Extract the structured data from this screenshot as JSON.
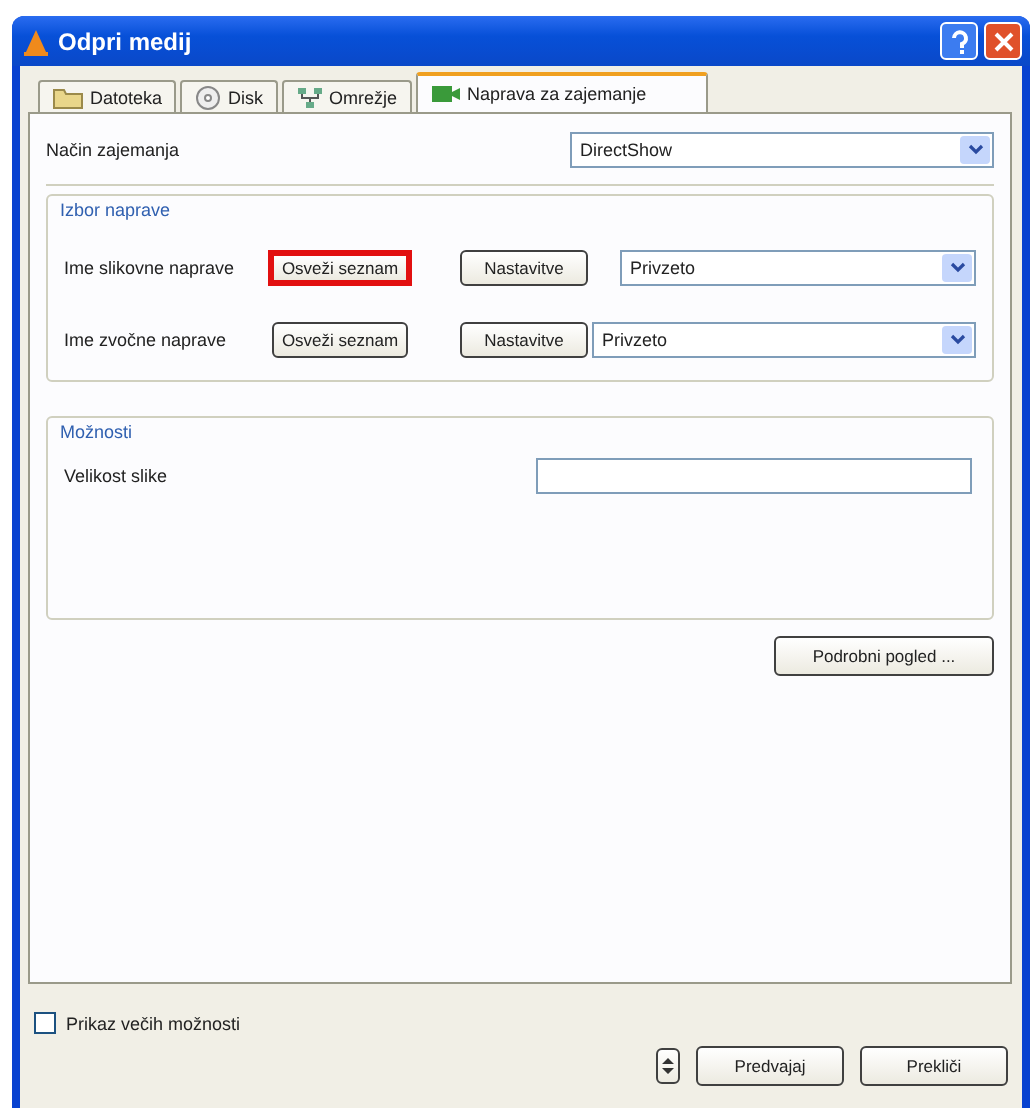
{
  "window": {
    "title": "Odpri medij"
  },
  "tabs": [
    {
      "label": "Datoteka",
      "kind": "file",
      "selected": false
    },
    {
      "label": "Disk",
      "kind": "disc",
      "selected": false
    },
    {
      "label": "Omrežje",
      "kind": "network",
      "selected": false
    },
    {
      "label": "Naprava za zajemanje",
      "kind": "capture",
      "selected": true
    }
  ],
  "capture_mode": {
    "label": "Način zajemanja",
    "value": "DirectShow"
  },
  "device_group": {
    "title": "Izbor naprave",
    "rows": [
      {
        "label": "Ime slikovne naprave",
        "refresh": "Osveži seznam",
        "refresh_highlighted": true,
        "settings": "Nastavitve",
        "value": "Privzeto"
      },
      {
        "label": "Ime zvočne naprave",
        "refresh": "Osveži seznam",
        "refresh_highlighted": false,
        "settings": "Nastavitve",
        "value": "Privzeto"
      }
    ]
  },
  "options_group": {
    "title": "Možnosti",
    "field_label": "Velikost slike"
  },
  "details_button": "Podrobni pogled ...",
  "more_options": {
    "label": "Prikaz večih možnosti",
    "checked": false
  },
  "buttons": [
    "Predvajaj",
    "Prekliči"
  ]
}
